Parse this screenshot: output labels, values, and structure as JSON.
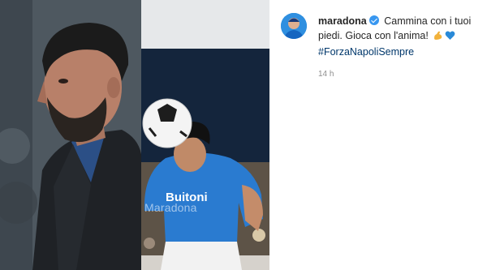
{
  "post": {
    "username": "maradona",
    "caption_text": "Cammina con i tuoi piedi. Gioca con l'anima!",
    "emojis": [
      "flexed-biceps-emoji",
      "blue-heart-emoji"
    ],
    "hashtag": "#ForzaNapoliSempre",
    "timestamp": "14 h"
  },
  "photos": {
    "center_watermark": "Maradona",
    "jersey_sponsor": "Buitoni"
  },
  "colors": {
    "verified_badge": "#3897f0",
    "hashtag": "#00376b",
    "timestamp": "#8e8e8e",
    "jersey_blue": "#2a7bd0"
  },
  "icons": [
    "verified-badge-icon",
    "avatar"
  ]
}
